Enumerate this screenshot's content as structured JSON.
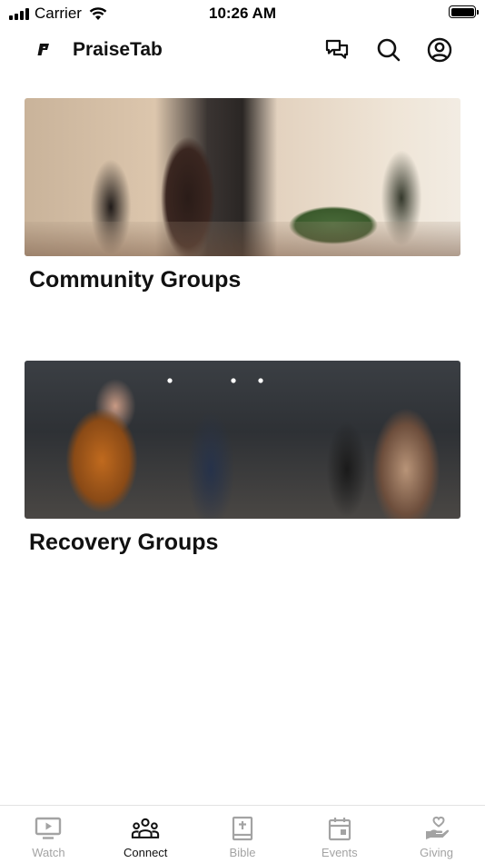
{
  "status_bar": {
    "carrier": "Carrier",
    "time": "10:26 AM"
  },
  "header": {
    "app_title": "PraiseTab",
    "icons": [
      "chat-icon",
      "search-icon",
      "account-icon"
    ]
  },
  "groups": [
    {
      "title": "Community Groups",
      "image": "community-groups-photo"
    },
    {
      "title": "Recovery Groups",
      "image": "recovery-groups-photo"
    }
  ],
  "tab_bar": {
    "active_tab": "Connect",
    "active_color": "#111111",
    "inactive_color": "#a3a3a3",
    "tabs": [
      {
        "label": "Watch",
        "icon": "tv-play-icon"
      },
      {
        "label": "Connect",
        "icon": "people-icon"
      },
      {
        "label": "Bible",
        "icon": "bible-icon"
      },
      {
        "label": "Events",
        "icon": "calendar-icon"
      },
      {
        "label": "Giving",
        "icon": "hand-heart-icon"
      }
    ]
  }
}
